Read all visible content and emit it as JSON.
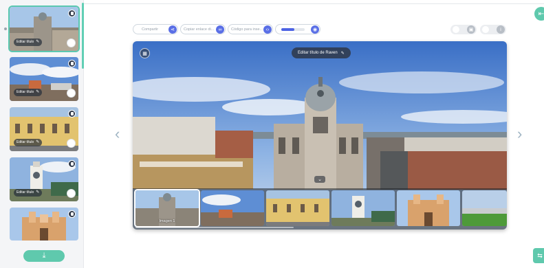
{
  "sidebar": {
    "items": [
      {
        "edit_label": "Editar título",
        "scene": "tower",
        "selected": true
      },
      {
        "edit_label": "Editar título",
        "scene": "sky",
        "selected": false
      },
      {
        "edit_label": "Editar título",
        "scene": "yellow-building",
        "selected": false
      },
      {
        "edit_label": "Editar título",
        "scene": "clock-tower",
        "selected": false
      },
      {
        "edit_label": "",
        "scene": "church",
        "selected": false
      }
    ],
    "download_icon": "download-icon"
  },
  "toolbar": {
    "share_placeholder": "Compartir",
    "share_icon": "share-icon",
    "copy_link_placeholder": "Copiar enlace di...",
    "copy_link_icon": "link-icon",
    "embed_placeholder": "Código para inse...",
    "embed_icon": "code-icon",
    "zoom_level": 0.55,
    "visibility_icon": "eye-icon",
    "toggle_one_icon": "lock-icon",
    "toggle_two_icon": "info-icon",
    "exit_icon": "exit-icon"
  },
  "viewer": {
    "title_label": "Editar título de Raven",
    "mode_icon": "view-mode-icon",
    "collapse_icon": "chevron-down-icon",
    "prev_icon": "‹",
    "next_icon": "›",
    "strip": [
      {
        "label": "Imagen 1",
        "scene": "tower",
        "selected": true
      },
      {
        "label": "",
        "scene": "sky",
        "selected": false
      },
      {
        "label": "",
        "scene": "yellow-building",
        "selected": false
      },
      {
        "label": "",
        "scene": "clock-tower",
        "selected": false
      },
      {
        "label": "",
        "scene": "church",
        "selected": false
      },
      {
        "label": "",
        "scene": "field",
        "selected": false
      }
    ]
  },
  "colors": {
    "accent": "#5fc9ad",
    "primary": "#5a6fe6"
  }
}
